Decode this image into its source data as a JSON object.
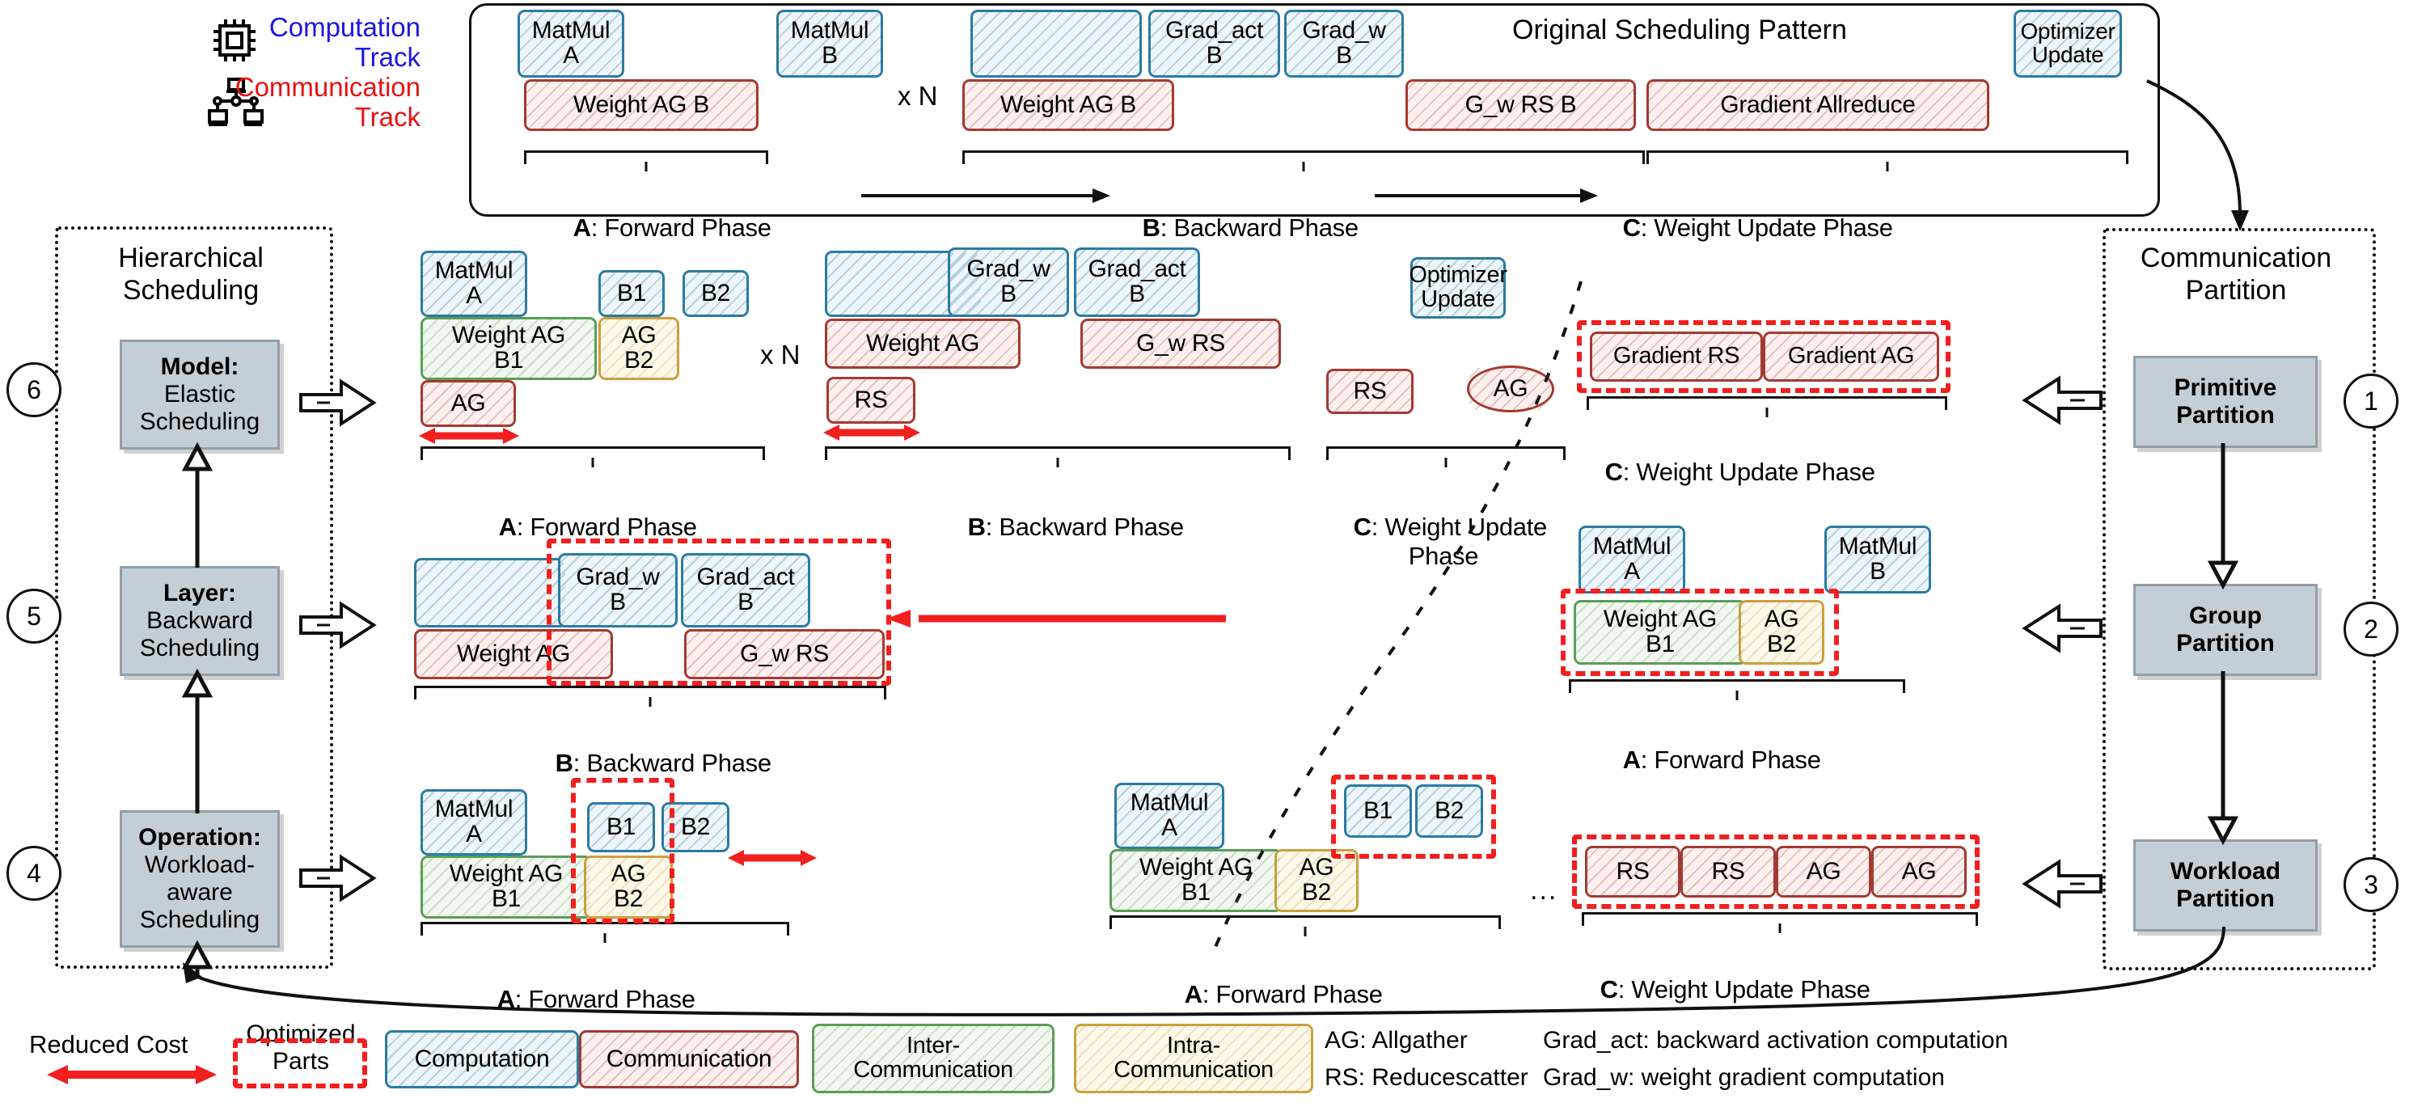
{
  "tracks": {
    "computation_label": "Computation\nTrack",
    "communication_label": "Communication\nTrack",
    "computation_color": "#1a16e0",
    "communication_color": "#e81212",
    "cpu_icon": "cpu-chip-icon",
    "network_icon": "network-nodes-icon"
  },
  "top_panel": {
    "title": "Original Scheduling Pattern",
    "comp_ops": [
      {
        "label": "MatMul\nA"
      },
      {
        "label": "MatMul\nB"
      },
      {
        "label": ""
      },
      {
        "label": "Grad_act\nB"
      },
      {
        "label": "Grad_w\nB"
      },
      {
        "label": "Optimizer\nUpdate"
      }
    ],
    "comm_ops": [
      {
        "label": "Weight AG B"
      },
      {
        "label": "Weight AG B"
      },
      {
        "label": "G_w RS B"
      },
      {
        "label": "Gradient Allreduce"
      }
    ],
    "repeat_label": "x N",
    "phases": [
      {
        "key": "A",
        "name": "Forward Phase"
      },
      {
        "key": "B",
        "name": "Backward Phase"
      },
      {
        "key": "C",
        "name": "Weight Update Phase"
      }
    ]
  },
  "left_panel": {
    "title": "Hierarchical\nScheduling",
    "levels": [
      {
        "num": "6",
        "head": "Model:",
        "body": "Elastic\nScheduling"
      },
      {
        "num": "5",
        "head": "Layer:",
        "body": "Backward\nScheduling"
      },
      {
        "num": "4",
        "head": "Operation:",
        "body": "Workload-\naware\nScheduling"
      }
    ]
  },
  "right_panel": {
    "title": "Communication\nPartition",
    "levels": [
      {
        "num": "1",
        "head": "Primitive",
        "body": "Partition"
      },
      {
        "num": "2",
        "head": "Group",
        "body": "Partition"
      },
      {
        "num": "3",
        "head": "Workload",
        "body": "Partition"
      }
    ]
  },
  "model_row": {
    "forward": {
      "comp": [
        "MatMul\nA",
        "B1",
        "B2"
      ],
      "inter": [
        "Weight AG\nB1"
      ],
      "intra": [
        "AG\nB2"
      ],
      "comm": [
        "AG"
      ],
      "repeat_label": "x N",
      "phase": "A: Forward Phase"
    },
    "backward": {
      "comp": [
        "",
        "Grad_w\nB",
        "Grad_act\nB"
      ],
      "comm": [
        "Weight AG",
        "G_w RS",
        "RS"
      ],
      "phase": "B: Backward Phase"
    },
    "update": {
      "comp": [
        "Optimizer\nUpdate"
      ],
      "comm": [
        "RS",
        "AG"
      ],
      "phase": "C: Weight Update\nPhase"
    }
  },
  "layer_row": {
    "comp": [
      "",
      "Grad_w\nB",
      "Grad_act\nB"
    ],
    "comm": [
      "Weight AG",
      "G_w RS"
    ],
    "phase": "B: Backward Phase"
  },
  "operation_row": {
    "comp": [
      "MatMul\nA",
      "B1",
      "B2"
    ],
    "inter": [
      "Weight AG\nB1"
    ],
    "intra": [
      "AG\nB2"
    ],
    "phase": "A: Forward Phase"
  },
  "primitive_row": {
    "comm": [
      "Gradient RS",
      "Gradient AG"
    ],
    "phase": "C: Weight Update Phase"
  },
  "group_row": {
    "comp": [
      "MatMul\nA",
      "MatMul\nB"
    ],
    "inter": [
      "Weight AG\nB1"
    ],
    "intra": [
      "AG\nB2"
    ],
    "phase": "A: Forward Phase"
  },
  "workload_row": {
    "comm": [
      "RS",
      "RS",
      "AG",
      "AG"
    ],
    "phase": "C: Weight Update Phase"
  },
  "middle_row": {
    "comp": [
      "MatMul\nA",
      "B1",
      "B2"
    ],
    "inter": [
      "Weight AG\nB1"
    ],
    "intra": [
      "AG\nB2"
    ],
    "ellipsis": "...",
    "phase": "A: Forward Phase"
  },
  "legend": {
    "reduced_cost": "Reduced Cost",
    "optimized_parts": "Optimized\nParts",
    "boxes": [
      {
        "label": "Computation",
        "kind": "c-comp"
      },
      {
        "label": "Communication",
        "kind": "c-comm"
      },
      {
        "label": "Inter-\nCommunication",
        "kind": "c-inter"
      },
      {
        "label": "Intra-\nCommunication",
        "kind": "c-intra"
      }
    ],
    "abbrev": [
      "AG: Allgather",
      "RS: Reducescatter",
      "Grad_act: backward activation computation",
      "Grad_w: weight gradient computation"
    ]
  }
}
